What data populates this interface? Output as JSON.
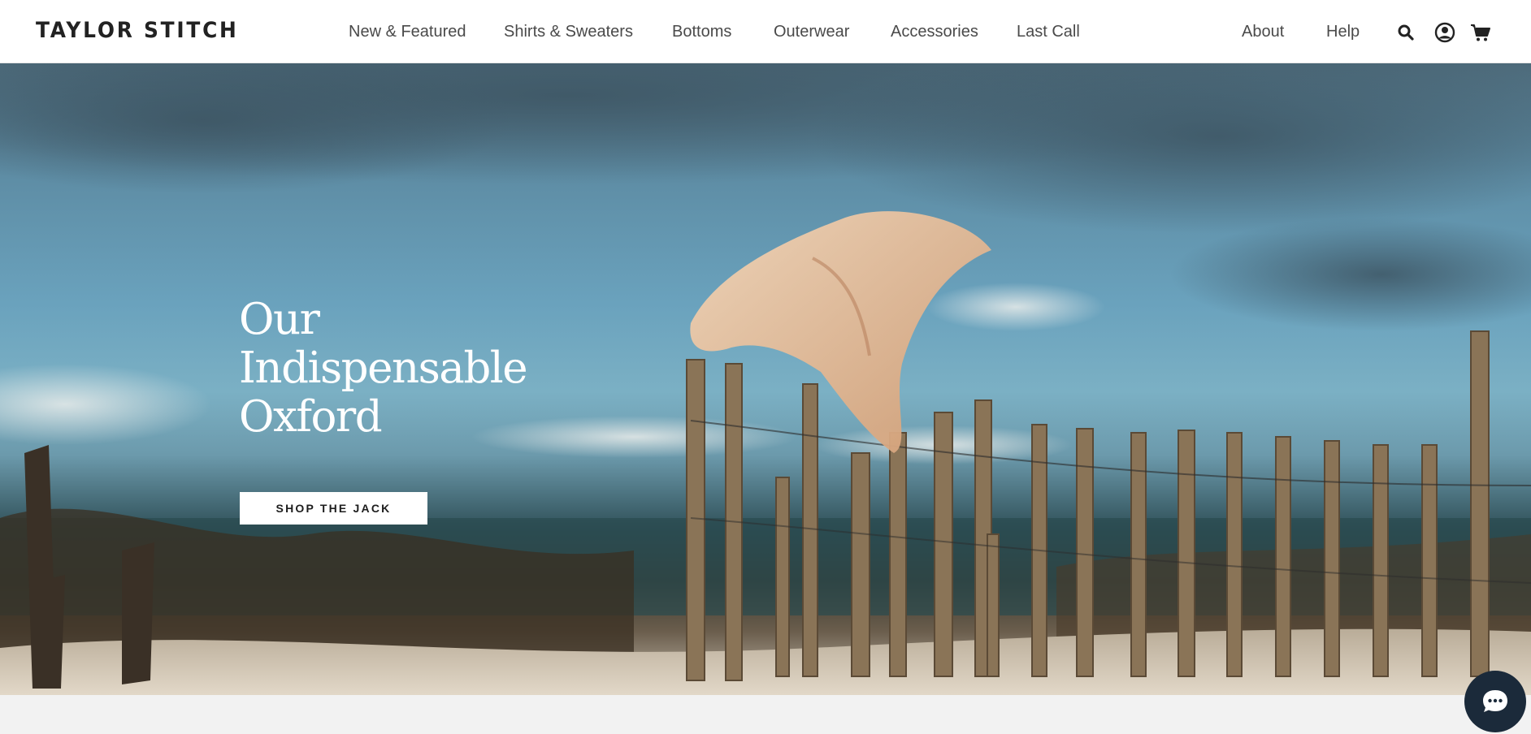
{
  "brand": {
    "logo_text": "TAYLOR STITCH"
  },
  "nav": {
    "items": [
      {
        "label": "New & Featured"
      },
      {
        "label": "Shirts & Sweaters"
      },
      {
        "label": "Bottoms"
      },
      {
        "label": "Outerwear"
      },
      {
        "label": "Accessories"
      },
      {
        "label": "Last Call"
      }
    ],
    "secondary": [
      {
        "label": "About"
      },
      {
        "label": "Help"
      }
    ],
    "icons": [
      "search-icon",
      "account-icon",
      "cart-icon"
    ]
  },
  "hero": {
    "title_lines": [
      "Our",
      "Indispensable",
      "Oxford"
    ],
    "cta_label": "SHOP THE JACK"
  },
  "chat": {
    "icon": "chat-icon"
  },
  "colors": {
    "header_bg": "#ffffff",
    "text_dark": "#222222",
    "nav_text": "#4a4a4a",
    "cta_bg": "#ffffff",
    "chat_bg": "#1b2a3a",
    "page_bg": "#f2f2f2"
  }
}
